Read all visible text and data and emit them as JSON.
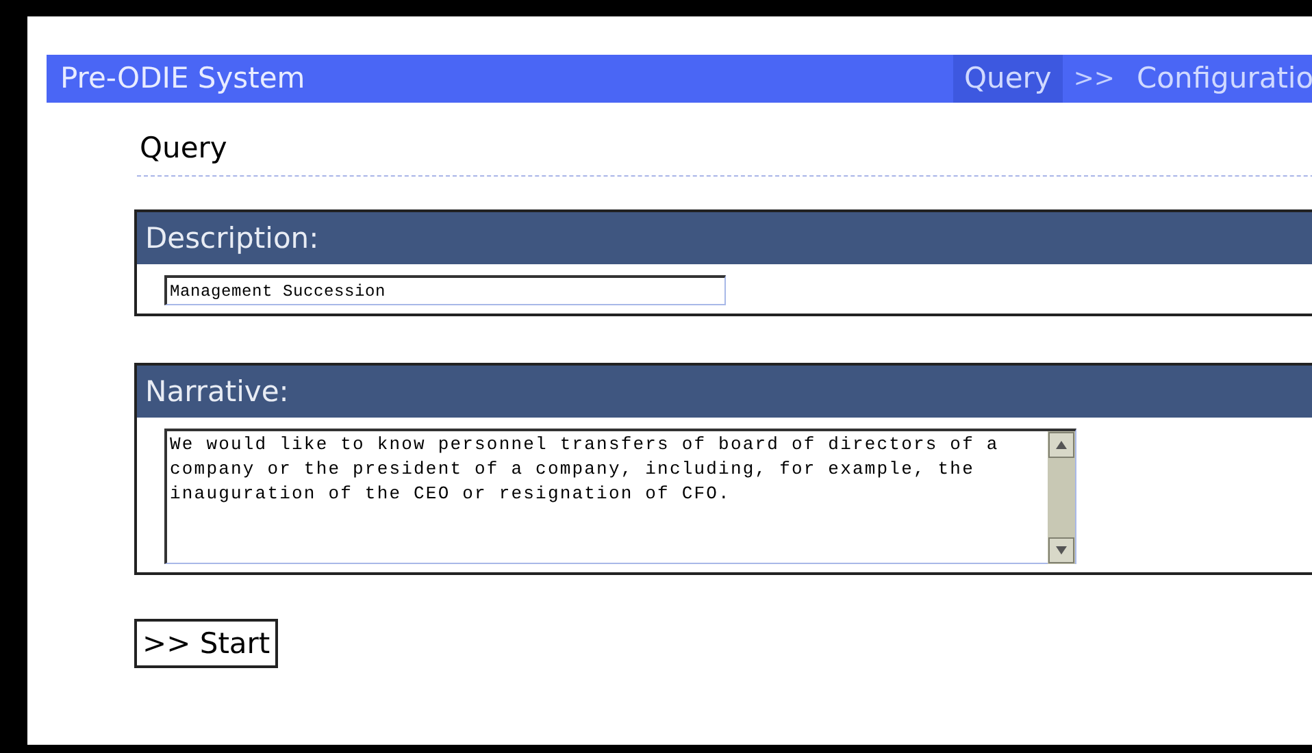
{
  "header": {
    "title": "Pre-ODIE System",
    "steps": [
      {
        "label": "Query",
        "selected": true
      },
      {
        "label": ">>",
        "kind": "separator",
        "selected": false
      },
      {
        "label": "Configuratio",
        "selected": false
      }
    ]
  },
  "page_title": "Query",
  "sections": [
    {
      "label": "Description:",
      "kind": "line",
      "value": "Management Succession"
    },
    {
      "label": "Narrative:",
      "kind": "area",
      "value": "We would like to know personnel transfers of board of directors of a company or the president of a company, including, for example, the inauguration of the CEO or resignation of CFO."
    }
  ],
  "start_button": ">> Start"
}
